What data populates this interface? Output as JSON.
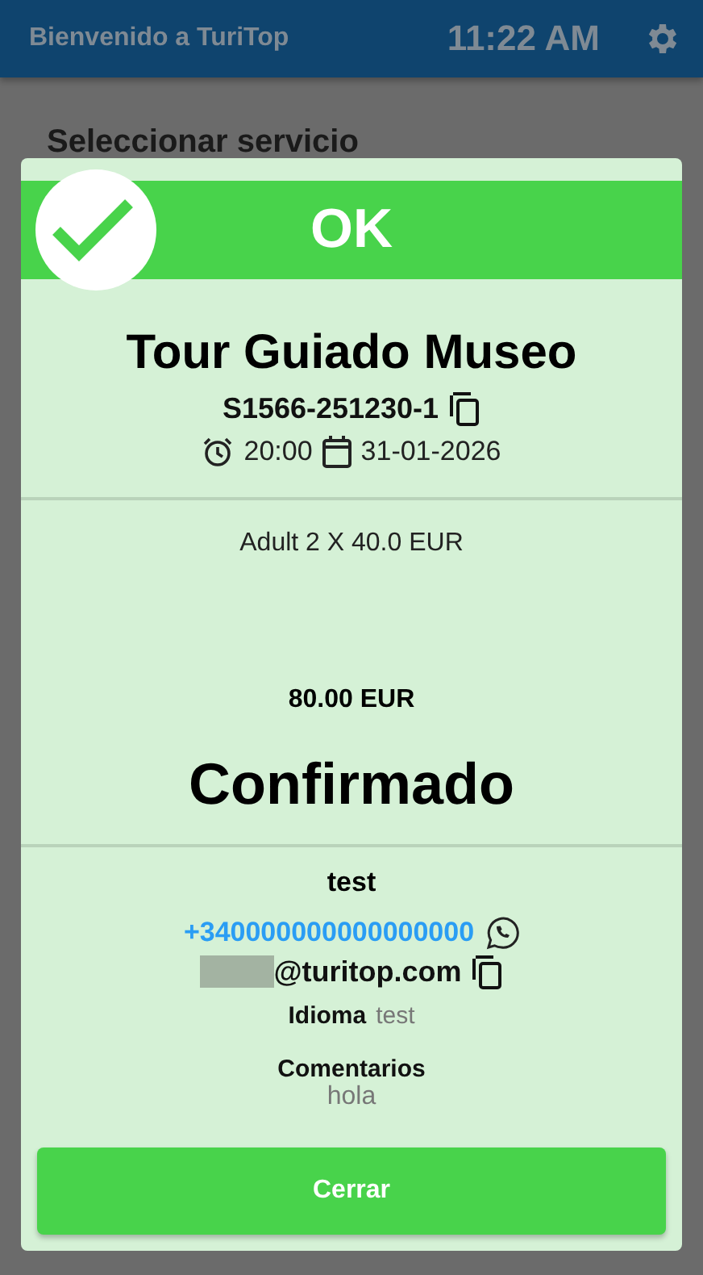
{
  "app_bar": {
    "title": "Bienvenido a TuriTop",
    "time": "11:22 AM"
  },
  "page": {
    "heading": "Seleccionar servicio"
  },
  "dialog": {
    "status": {
      "kind": "success",
      "label": "OK"
    },
    "tour_name": "Tour Guiado Museo",
    "booking_code": "S1566-251230-1",
    "time": "20:00",
    "date": "31-01-2026",
    "line_items": [
      "Adult 2 X 40.0 EUR"
    ],
    "total": "80.00 EUR",
    "booking_state": "Confirmado",
    "customer": {
      "name": "test",
      "phone": "+340000000000000000",
      "email": "@turitop.com",
      "email_redacted": true
    },
    "language": {
      "label": "Idioma",
      "value": "test"
    },
    "comments": {
      "label": "Comentarios",
      "value": "hola"
    },
    "close_button": "Cerrar"
  }
}
